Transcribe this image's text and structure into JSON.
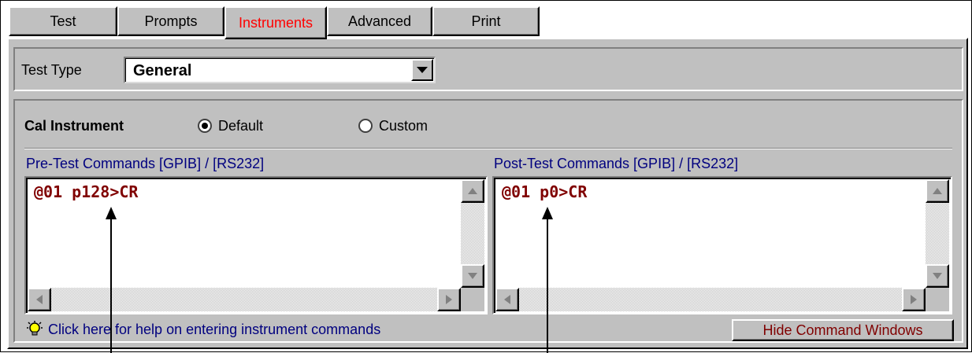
{
  "tabs": [
    {
      "label": "Test"
    },
    {
      "label": "Prompts"
    },
    {
      "label": "Instruments",
      "active": true
    },
    {
      "label": "Advanced"
    },
    {
      "label": "Print"
    }
  ],
  "test_type": {
    "label": "Test Type",
    "value": "General"
  },
  "cal_instrument": {
    "label": "Cal Instrument",
    "options": [
      {
        "label": "Default",
        "selected": true
      },
      {
        "label": "Custom",
        "selected": false
      }
    ]
  },
  "pre_test": {
    "label": "Pre-Test Commands [GPIB] / [RS232]",
    "command": "@01 p128>CR"
  },
  "post_test": {
    "label": "Post-Test Commands [GPIB] / [RS232]",
    "command": "@01 p0>CR"
  },
  "help_link": "Click here for help on entering instrument commands",
  "hide_button": "Hide Command Windows",
  "colors": {
    "active_tab": "#ff0000",
    "command_text": "#800000",
    "link_text": "#00007f",
    "panel_bg": "#c0c0c0"
  }
}
